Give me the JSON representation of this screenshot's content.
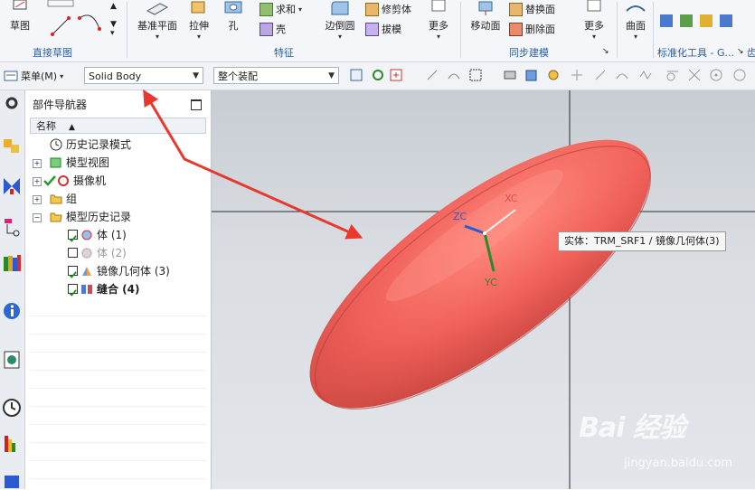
{
  "ribbon": {
    "sketch_label": "草图",
    "direct_sketch_group": "直接草图",
    "datum_plane_label": "基准平面",
    "extrude_label": "拉伸",
    "hole_label": "孔",
    "unite_label": "求和",
    "shell_label": "壳",
    "feature_group": "特征",
    "edge_blend_label": "边倒圆",
    "trim_body_label": "修剪体",
    "draft_label": "拔模",
    "more_label": "更多",
    "move_face_label": "移动面",
    "replace_face_label": "替换面",
    "delete_face_label": "删除面",
    "more2_label": "更多",
    "sync_group": "同步建模",
    "surface_label": "曲面",
    "std_tools_group": "标准化工具 - G...",
    "extra_group": "齿"
  },
  "toolbar": {
    "menu_label": "菜单(M)",
    "filter_value": "Solid Body",
    "assembly_value": "整个装配"
  },
  "navigator": {
    "title": "部件导航器",
    "column_header": "名称",
    "items": [
      {
        "label": "历史记录模式"
      },
      {
        "label": "模型视图"
      },
      {
        "label": "摄像机"
      },
      {
        "label": "组"
      },
      {
        "label": "模型历史记录"
      },
      {
        "label": "体 (1)"
      },
      {
        "label": "体 (2)"
      },
      {
        "label": "镜像几何体 (3)"
      },
      {
        "label": "缝合 (4)"
      }
    ]
  },
  "viewport": {
    "axis_xc": "XC",
    "axis_yc": "YC",
    "axis_zc": "ZC",
    "tooltip": "实体：TRM_SRF1 / 镜像几何体(3)",
    "watermark": "Bai 经验",
    "watermark_url": "jingyan.baidu.com"
  },
  "colors": {
    "body": "#f0615a",
    "annotation_arrow": "#e8392f",
    "link": "#2b5ea7"
  }
}
